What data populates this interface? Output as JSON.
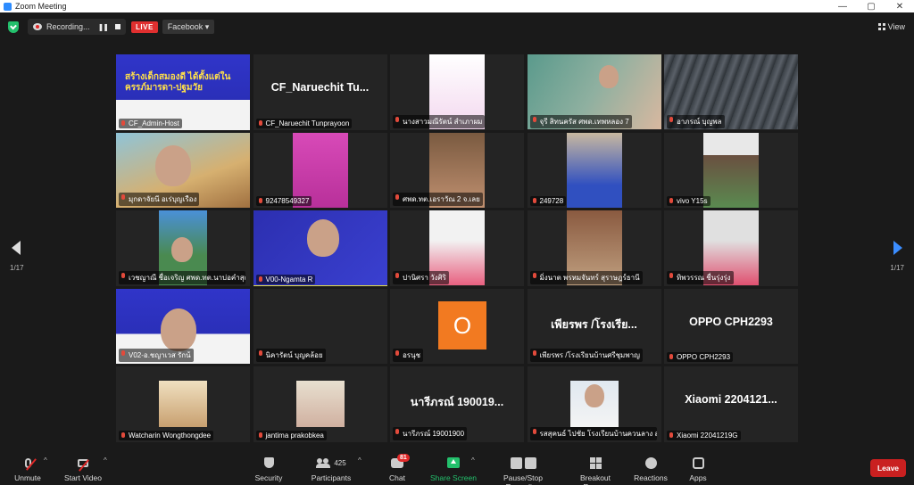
{
  "window": {
    "title": "Zoom Meeting",
    "controls": [
      "—",
      "▢",
      "✕"
    ]
  },
  "topbar": {
    "recording_label": "Recording...",
    "live_label": "LIVE",
    "stream_target": "Facebook ▾",
    "view_label": "View"
  },
  "pagination": {
    "left": "1/17",
    "right": "1/17"
  },
  "tiles": [
    {
      "label": "CF_Admin-Host",
      "poster_title": "สร้างเด็กสมองดี ได้ตั้งแต่ในครรภ์มารดา-ปฐมวัย"
    },
    {
      "label": "CF_Naruechit Tunprayoon",
      "big": "CF_Naruechit Tu..."
    },
    {
      "label": "นางสาวมณีรัตน์ สำเภาผม"
    },
    {
      "label": "จุรี สิทนครัส ศพด.เทพหลอง 7"
    },
    {
      "label": "อาภรณ์ บุญพล"
    },
    {
      "label": "มุกดาจัยนี อเร่บุญเรือง"
    },
    {
      "label": "92478549327"
    },
    {
      "label": "ศพด.ทต.เอราวัณ 2 จ.เลย"
    },
    {
      "label": "249728"
    },
    {
      "label": "vivo Y15s"
    },
    {
      "label": "เวชญาณี ชื่อเจริญ ศพด.ทต.นาบ่อคำสุด"
    },
    {
      "label": "V00-Ngamta R"
    },
    {
      "label": "ปานิศรา วังศิริ"
    },
    {
      "label": "มิ่งนาต พรหมจันทร์ สุราษฎร์ธานี"
    },
    {
      "label": "ทิพวรรณ ชื่นรุ่งรุ่ง"
    },
    {
      "label": "V02-อ.ชญาเวส รักน้"
    },
    {
      "label": "นิคารัตน์ บุญคล้อย"
    },
    {
      "label": "อรนุช",
      "initial": "O"
    },
    {
      "label": "เพียรพร /โรงเรียนบ้านศรีชุมพาญ",
      "big": "เพียรพร /โรงเรีย..."
    },
    {
      "label": "OPPO CPH2293",
      "big": "OPPO CPH2293"
    },
    {
      "label": "Watcharin Wongthongdee"
    },
    {
      "label": "jantima prakobkea"
    },
    {
      "label": "นารีภรณ์ 19001900",
      "big": "นารีภรณ์ 190019..."
    },
    {
      "label": "รสสุคนธ์ ไปชัย โรงเรียนบ้านควนลาง ส."
    },
    {
      "label": "Xiaomi 22041219G",
      "big": "Xiaomi  2204121..."
    }
  ],
  "toolbar": {
    "unmute": "Unmute",
    "start_video": "Start Video",
    "security": "Security",
    "participants": "Participants",
    "participant_count": "425",
    "chat": "Chat",
    "chat_badge": "81",
    "share_screen": "Share Screen",
    "pause_stop": "Pause/Stop Recording",
    "breakout": "Breakout Rooms",
    "reactions": "Reactions",
    "apps": "Apps",
    "leave": "Leave"
  },
  "colors": {
    "share": "#23c06c",
    "leave": "#c92020",
    "live": "#e02f2f",
    "active_speaker": "#e6e04a"
  }
}
